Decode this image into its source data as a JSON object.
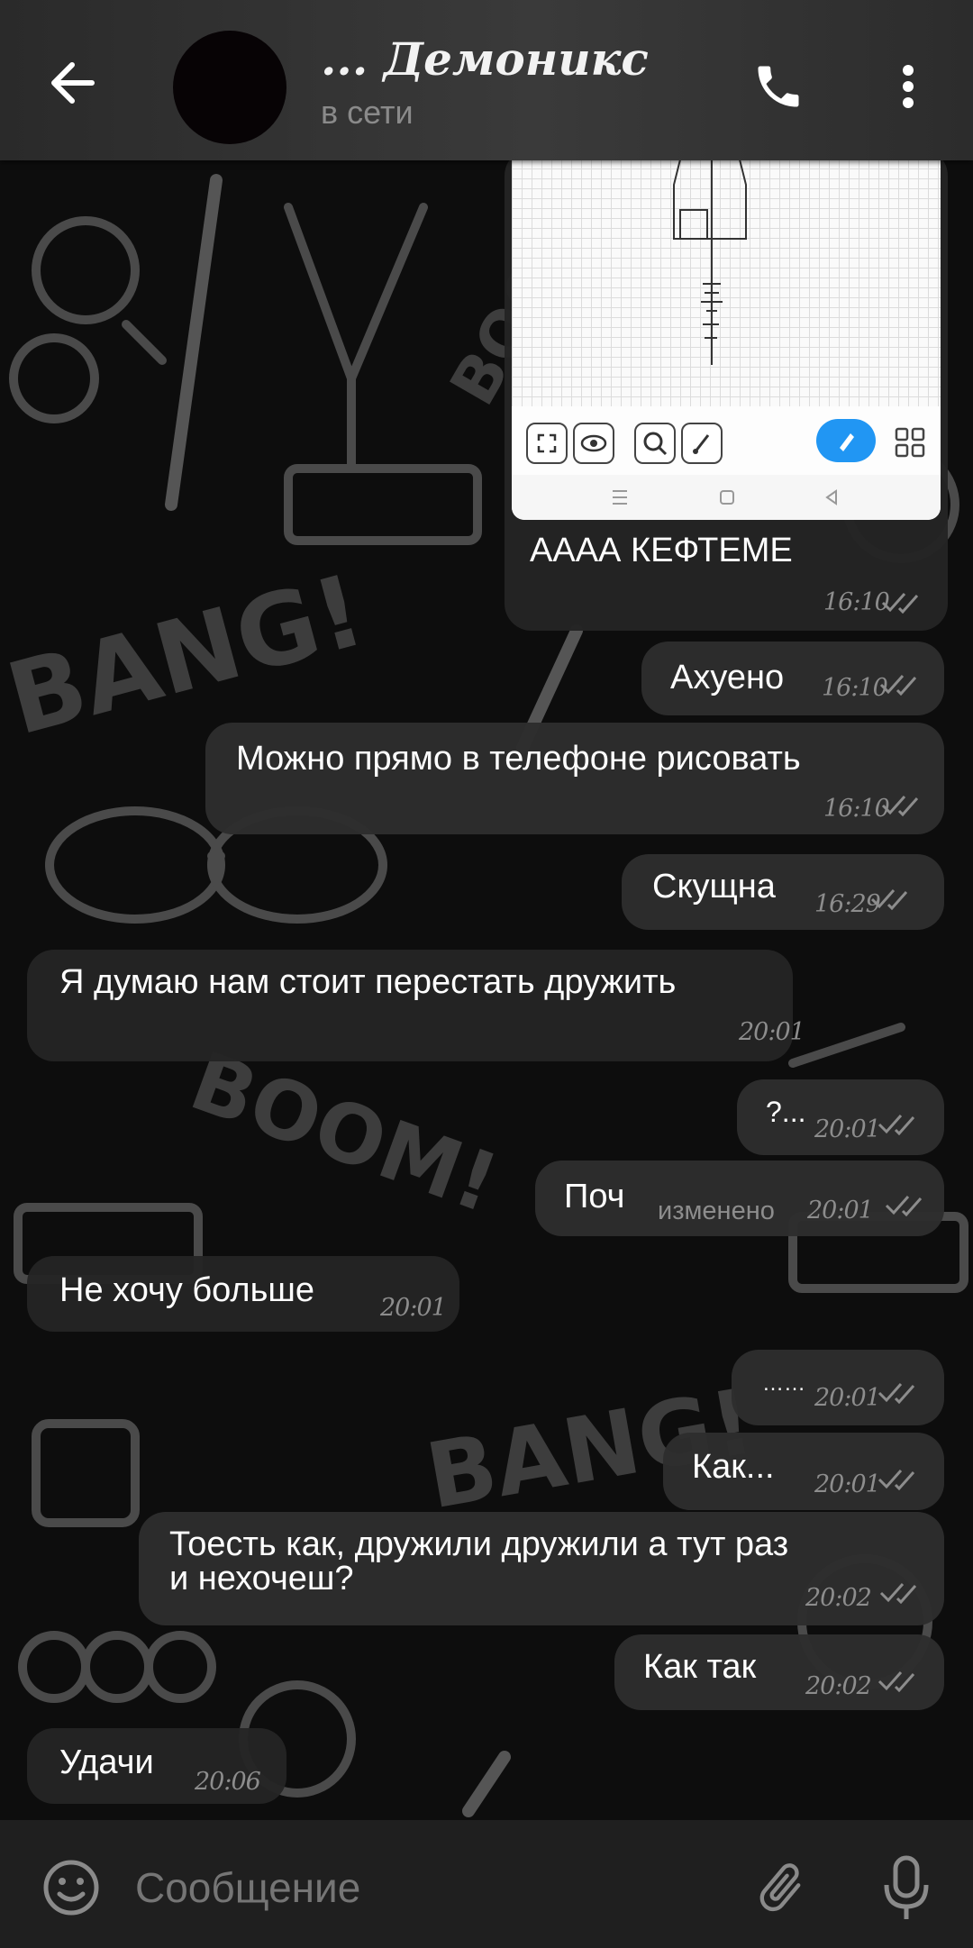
{
  "header": {
    "title": "... Демоникс",
    "status": "в сети"
  },
  "image_message": {
    "caption": "АААА КЕФТЕМЕ",
    "time": "16:10"
  },
  "messages": [
    {
      "id": "m1",
      "direction": "out",
      "text": "Ахуено",
      "time": "16:10"
    },
    {
      "id": "m2",
      "direction": "out",
      "text": "Можно прямо в телефоне рисовать",
      "time": "16:10"
    },
    {
      "id": "m3",
      "direction": "out",
      "text": "Скущна",
      "time": "16:29"
    },
    {
      "id": "m4",
      "direction": "in",
      "text": "Я думаю нам стоит перестать дружить",
      "time": "20:01"
    },
    {
      "id": "m5",
      "direction": "out",
      "text": "?...",
      "time": "20:01"
    },
    {
      "id": "m6",
      "direction": "out",
      "text": "Поч",
      "edited": "изменено",
      "time": "20:01"
    },
    {
      "id": "m7",
      "direction": "in",
      "text": "Не хочу больше",
      "time": "20:01"
    },
    {
      "id": "m8",
      "direction": "out",
      "text": "……",
      "time": "20:01"
    },
    {
      "id": "m9",
      "direction": "out",
      "text": "Как...",
      "time": "20:01"
    },
    {
      "id": "m10",
      "direction": "out",
      "text_line1": "Тоесть как, дружили дружили а тут раз",
      "text_line2": "и нехочеш?",
      "time": "20:02"
    },
    {
      "id": "m11",
      "direction": "out",
      "text": "Как так",
      "time": "20:02"
    },
    {
      "id": "m12",
      "direction": "in",
      "text": "Удачи",
      "time": "20:06"
    }
  ],
  "input": {
    "placeholder": "Сообщение"
  },
  "icons": {
    "back": "arrow-left-icon",
    "call": "phone-icon",
    "menu": "more-vertical-icon",
    "emoji": "smile-icon",
    "attach": "paperclip-icon",
    "mic": "microphone-icon",
    "read": "double-check-icon"
  },
  "colors": {
    "bubble": "#2d2d2d",
    "header": "#333333",
    "meta": "#8d8d8d",
    "accent_fab": "#2196f3"
  }
}
